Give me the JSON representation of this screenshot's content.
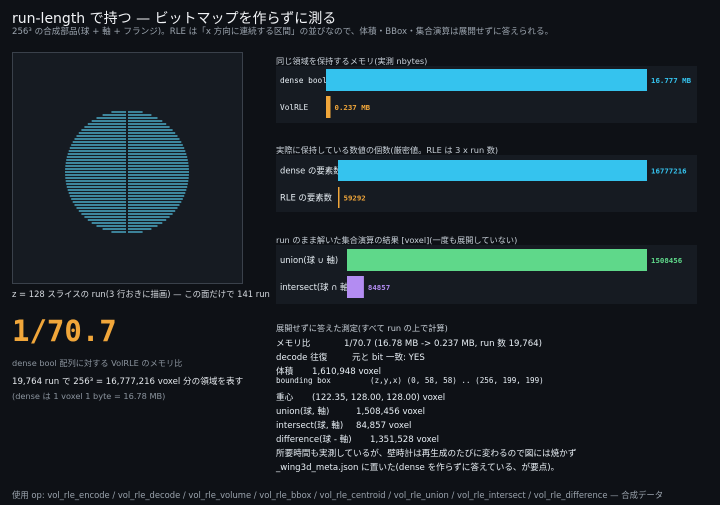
{
  "header": {
    "title": "run-length で持つ — ビットマップを作らずに測る",
    "subtitle": "256³ の合成部品(球 + 軸 + フランジ)。RLE は「x 方向に連続する区間」の並びなので、体積・BBox・集合演算は展開せずに答えられる。"
  },
  "slice_panel": {
    "caption": "z = 128 スライスの run(3 行おきに描画) — この面だけで 141 run",
    "line_color": "#56c8e8"
  },
  "ratio": {
    "big": "1/70.7",
    "label": "dense bool 配列に対する VolRLE のメモリ比",
    "detail": "19,764 run で 256³ = 16,777,216 voxel 分の領域を表す",
    "note": "(dense は 1 voxel 1 byte = 16.78 MB)"
  },
  "chart_data": [
    {
      "type": "bar",
      "orientation": "horizontal",
      "title": "同じ領域を保持するメモリ(実測 nbytes)",
      "categories": [
        "dense bool",
        "VolRLE"
      ],
      "values": [
        16.777,
        0.237
      ],
      "value_labels": [
        "16.777 MB",
        "0.237 MB"
      ],
      "colors": [
        "#35c3ee",
        "#f0a63a"
      ],
      "xlim": [
        0,
        16.777
      ]
    },
    {
      "type": "bar",
      "orientation": "horizontal",
      "title": "実際に保持している数値の個数(厳密値。RLE は 3 x run 数)",
      "categories": [
        "dense の要素数",
        "RLE の要素数"
      ],
      "values": [
        16777216,
        59292
      ],
      "value_labels": [
        "16777216",
        "59292"
      ],
      "colors": [
        "#35c3ee",
        "#f0a63a"
      ],
      "xlim": [
        0,
        16777216
      ]
    },
    {
      "type": "bar",
      "orientation": "horizontal",
      "title": "run のまま解いた集合演算の結果 [voxel](一度も展開していない)",
      "categories": [
        "union(球 ∪ 軸)",
        "intersect(球 ∩ 軸)"
      ],
      "values": [
        1508456,
        84857
      ],
      "value_labels": [
        "1508456",
        "84857"
      ],
      "colors": [
        "#5fd88a",
        "#b38cf2"
      ],
      "xlim": [
        0,
        1508456
      ]
    }
  ],
  "measurements": {
    "title": "展開せずに答えた測定(すべて run の上で計算)",
    "rows": [
      {
        "key": "メモリ比",
        "value": "1/70.7  (16.78 MB -> 0.237 MB, run 数 19,764)"
      },
      {
        "key": "decode 往復",
        "value": "元と bit 一致: YES"
      },
      {
        "key": "体積",
        "value": "1,610,948 voxel"
      },
      {
        "key": "bounding box",
        "value": "(z,y,x) (0, 58, 58) .. (256, 199, 199)"
      },
      {
        "key": "重心",
        "value": "(122.35, 128.00, 128.00) voxel"
      },
      {
        "key": "union(球, 軸)",
        "value": "1,508,456 voxel"
      },
      {
        "key": "intersect(球, 軸)",
        "value": "84,857 voxel"
      },
      {
        "key": "difference(球 - 軸)",
        "value": "1,351,528 voxel"
      }
    ],
    "note_line1": "所要時間も実測しているが、壁時計は再生成のたびに変わるので図には焼かず",
    "note_line2": "_wing3d_meta.json に置いた(dense を作らずに答えている、が要点)。"
  },
  "footer": "使用 op: vol_rle_encode / vol_rle_decode / vol_rle_volume / vol_rle_bbox / vol_rle_centroid / vol_rle_union / vol_rle_intersect / vol_rle_difference — 合成データ"
}
